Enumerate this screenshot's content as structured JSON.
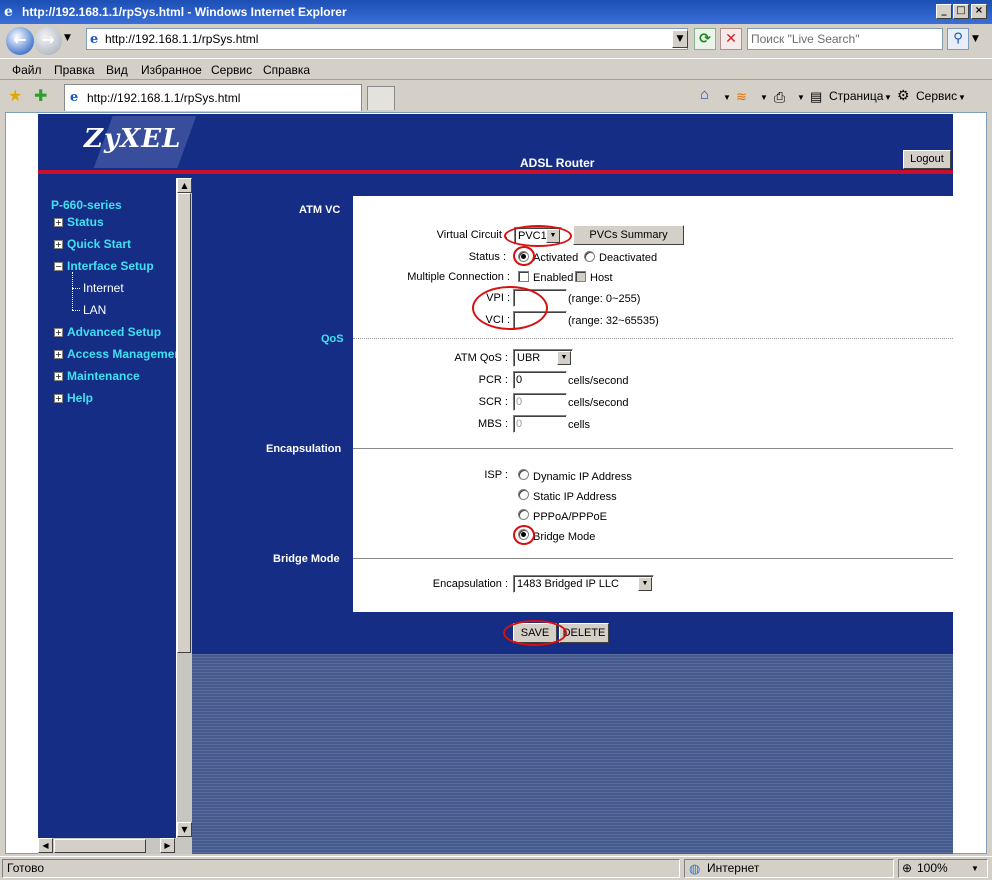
{
  "window": {
    "title": "http://192.168.1.1/rpSys.html - Windows Internet Explorer",
    "min_icon": "minimize-icon",
    "max_icon": "maximize-icon",
    "close_icon": "close-icon"
  },
  "toolbar": {
    "address": "http://192.168.1.1/rpSys.html",
    "search_placeholder": "Поиск \"Live Search\""
  },
  "menu": [
    "Файл",
    "Правка",
    "Вид",
    "Избранное",
    "Сервис",
    "Справка"
  ],
  "tabs": {
    "active_title": "http://192.168.1.1/rpSys.html"
  },
  "commandbar": {
    "page_label": "Страница",
    "tools_label": "Сервис"
  },
  "router": {
    "brand": "ZyXEL",
    "title": "ADSL Router",
    "logout_label": "Logout",
    "model": "P-660-series",
    "nav": [
      {
        "label": "Status",
        "expander": "plus"
      },
      {
        "label": "Quick Start",
        "expander": "plus"
      },
      {
        "label": "Interface Setup",
        "expander": "minus"
      },
      {
        "label": "Advanced Setup",
        "expander": "plus"
      },
      {
        "label": "Access Management",
        "expander": "plus"
      },
      {
        "label": "Maintenance",
        "expander": "plus"
      },
      {
        "label": "Help",
        "expander": "plus"
      }
    ],
    "subnav": [
      "Internet",
      "LAN"
    ]
  },
  "form": {
    "sections": {
      "atm_vc": "ATM VC",
      "qos": "QoS",
      "encapsulation": "Encapsulation",
      "bridge_mode": "Bridge Mode"
    },
    "virtual_circuit": {
      "label": "Virtual Circuit :",
      "value": "PVC1",
      "summary_button": "PVCs Summary"
    },
    "status": {
      "label": "Status :",
      "options": [
        "Activated",
        "Deactivated"
      ],
      "selected": "Activated"
    },
    "multiple_connection": {
      "label": "Multiple Connection :",
      "enabled_label": "Enabled",
      "host_label": "Host"
    },
    "vpi": {
      "label": "VPI :",
      "value": "",
      "range": "(range: 0~255)"
    },
    "vci": {
      "label": "VCI :",
      "value": "",
      "range": "(range: 32~65535)"
    },
    "atm_qos": {
      "label": "ATM QoS :",
      "value": "UBR"
    },
    "pcr": {
      "label": "PCR :",
      "value": "0",
      "unit": "cells/second"
    },
    "scr": {
      "label": "SCR :",
      "value": "0",
      "unit": "cells/second"
    },
    "mbs": {
      "label": "MBS :",
      "value": "0",
      "unit": "cells"
    },
    "isp": {
      "label": "ISP :",
      "options": [
        "Dynamic IP Address",
        "Static IP Address",
        "PPPoA/PPPoE",
        "Bridge Mode"
      ],
      "selected": "Bridge Mode"
    },
    "bridge_encapsulation": {
      "label": "Encapsulation :",
      "value": "1483 Bridged IP LLC"
    },
    "save_label": "SAVE",
    "delete_label": "DELETE"
  },
  "statusbar": {
    "left": "Готово",
    "zone": "Интернет",
    "zoom": "100%"
  },
  "colors": {
    "router_blue": "#152d85",
    "nav_cyan": "#3fe0f0",
    "accent_red": "#c8102e",
    "annotation_red": "#d81010"
  }
}
